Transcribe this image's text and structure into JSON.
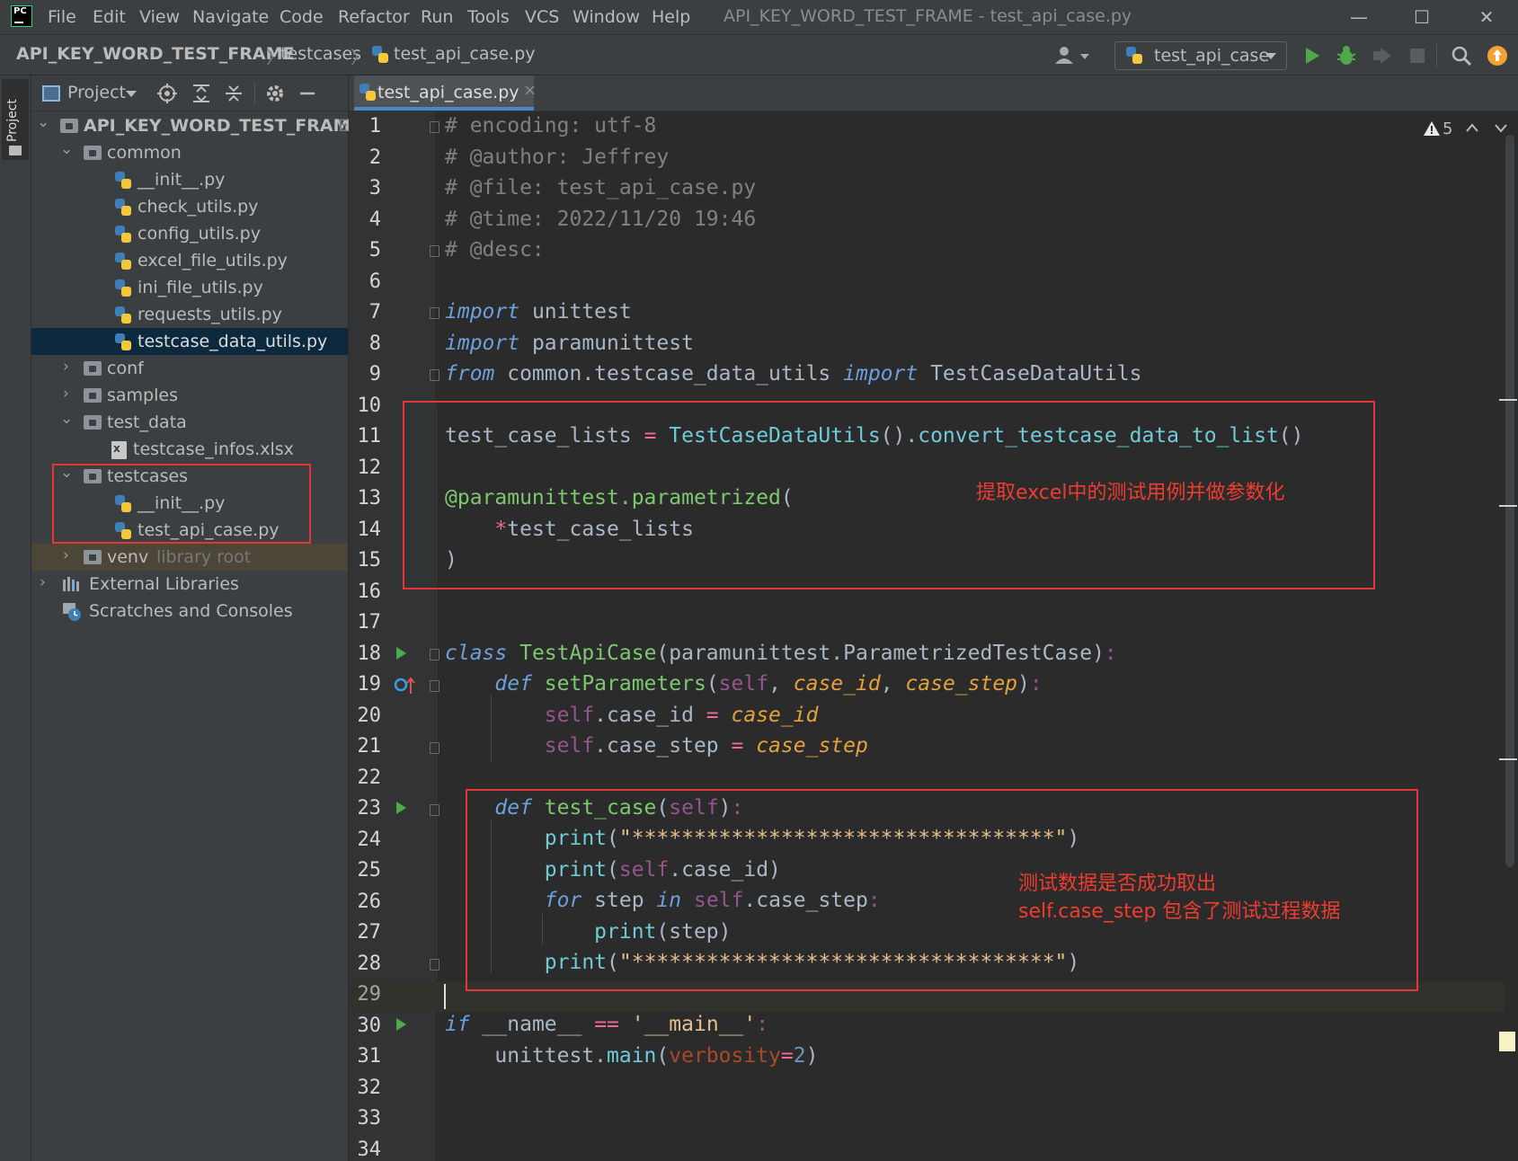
{
  "window": {
    "app_logo": "PC",
    "menu": [
      "File",
      "Edit",
      "View",
      "Navigate",
      "Code",
      "Refactor",
      "Run",
      "Tools",
      "VCS",
      "Window",
      "Help"
    ],
    "title": "API_KEY_WORD_TEST_FRAME - test_api_case.py",
    "controls": {
      "minimize": "—",
      "maximize": "☐",
      "close": "✕"
    }
  },
  "navbar": {
    "breadcrumbs": [
      "API_KEY_WORD_TEST_FRAME",
      "testcases",
      "test_api_case.py"
    ],
    "run_config": "test_api_case",
    "icons": [
      "user-icon",
      "python-icon",
      "run-icon",
      "debug-icon",
      "coverage-icon",
      "stop-icon",
      "search-icon",
      "update-icon"
    ]
  },
  "tool_strip": {
    "project_tab": "Project"
  },
  "project_panel": {
    "title": "Project",
    "root": {
      "label": "API_KEY_WORD_TEST_FRAME",
      "suffix": "E"
    },
    "items": [
      {
        "label": "common",
        "type": "folder",
        "expanded": true
      },
      {
        "label": "__init__.py",
        "type": "py"
      },
      {
        "label": "check_utils.py",
        "type": "py"
      },
      {
        "label": "config_utils.py",
        "type": "py"
      },
      {
        "label": "excel_file_utils.py",
        "type": "py"
      },
      {
        "label": "ini_file_utils.py",
        "type": "py"
      },
      {
        "label": "requests_utils.py",
        "type": "py"
      },
      {
        "label": "testcase_data_utils.py",
        "type": "py",
        "selected": true
      },
      {
        "label": "conf",
        "type": "folder",
        "expanded": false
      },
      {
        "label": "samples",
        "type": "folder",
        "expanded": false
      },
      {
        "label": "test_data",
        "type": "folder",
        "expanded": true
      },
      {
        "label": "testcase_infos.xlsx",
        "type": "xlsx"
      },
      {
        "label": "testcases",
        "type": "folder",
        "expanded": true
      },
      {
        "label": "__init__.py",
        "type": "py"
      },
      {
        "label": "test_api_case.py",
        "type": "py"
      },
      {
        "label": "venv",
        "type": "folder",
        "expanded": false,
        "hint": "library root"
      },
      {
        "label": "External Libraries",
        "type": "libs"
      },
      {
        "label": "Scratches and Consoles",
        "type": "scratches"
      }
    ]
  },
  "editor": {
    "tab_label": "test_api_case.py",
    "tab_close": "×",
    "warning_count": "5",
    "line_numbers": [
      "1",
      "2",
      "3",
      "4",
      "5",
      "6",
      "7",
      "8",
      "9",
      "10",
      "11",
      "12",
      "13",
      "14",
      "15",
      "16",
      "17",
      "18",
      "19",
      "20",
      "21",
      "22",
      "23",
      "24",
      "25",
      "26",
      "27",
      "28",
      "29",
      "30",
      "31",
      "32",
      "33",
      "34"
    ],
    "code": {
      "l1": "# encoding: utf-8",
      "l2": "# @author: Jeffrey",
      "l3": "# @file: test_api_case.py",
      "l4": "# @time: 2022/11/20 19:46",
      "l5": "# @desc:",
      "l7_kw": "import",
      "l7_rest": " unittest",
      "l8_kw": "import",
      "l8_rest": " paramunittest",
      "l9_kw1": "from",
      "l9_mod": " common.testcase_data_utils ",
      "l9_kw2": "import",
      "l9_cls": " TestCaseDataUtils",
      "l11_var": "test_case_lists ",
      "l11_eq": "=",
      "l11_cls": " TestCaseDataUtils",
      "l11_p1": "().",
      "l11_fn": "convert_testcase_data_to_list",
      "l11_p2": "()",
      "l13_dec": "@paramunittest.parametrized",
      "l13_p": "(",
      "l14_star": "*",
      "l14_var": "test_case_lists",
      "l15": ")",
      "l18_kw": "class",
      "l18_cls": " TestApiCase",
      "l18_rest": "(paramunittest.ParametrizedTestCase)",
      "l18_colon": ":",
      "l19_kw": "def",
      "l19_fn": " setParameters",
      "l19_p1": "(",
      "l19_self": "self",
      "l19_c1": ", ",
      "l19_a1": "case_id",
      "l19_c2": ", ",
      "l19_a2": "case_step",
      "l19_p2": ")",
      "l19_colon": ":",
      "l20_self": "self",
      "l20_attr": ".case_id ",
      "l20_eq": "=",
      "l20_val": " case_id",
      "l21_self": "self",
      "l21_attr": ".case_step ",
      "l21_eq": "=",
      "l21_val": " case_step",
      "l23_kw": "def",
      "l23_fn": " test_case",
      "l23_p1": "(",
      "l23_self": "self",
      "l23_p2": ")",
      "l23_colon": ":",
      "l24_fn": "print",
      "l24_p1": "(",
      "l24_str": "\"**********************************\"",
      "l24_p2": ")",
      "l25_fn": "print",
      "l25_p1": "(",
      "l25_self": "self",
      "l25_rest": ".case_id)",
      "l26_kw1": "for",
      "l26_var": " step ",
      "l26_kw2": "in",
      "l26_self": " self",
      "l26_rest": ".case_step",
      "l26_colon": ":",
      "l27_fn": "print",
      "l27_rest": "(step)",
      "l28_fn": "print",
      "l28_p1": "(",
      "l28_str": "\"**********************************\"",
      "l28_p2": ")",
      "l30_kw": "if",
      "l30_var": " __name__ ",
      "l30_eq": "==",
      "l30_sp": " ",
      "l30_str": "'__main__'",
      "l30_colon": ":",
      "l31_a": "unittest.",
      "l31_fn": "main",
      "l31_p1": "(",
      "l31_kw": "verbosity",
      "l31_eq": "=",
      "l31_num": "2",
      "l31_p2": ")"
    }
  },
  "annotations": {
    "box1": "提取excel中的测试用例并做参数化",
    "box2_line1": "测试数据是否成功取出",
    "box2_line2": "self.case_step 包含了测试过程数据"
  },
  "colors": {
    "annotation_red": "#e53535",
    "accent_blue": "#4a88c7",
    "run_green": "#4ea94a"
  }
}
